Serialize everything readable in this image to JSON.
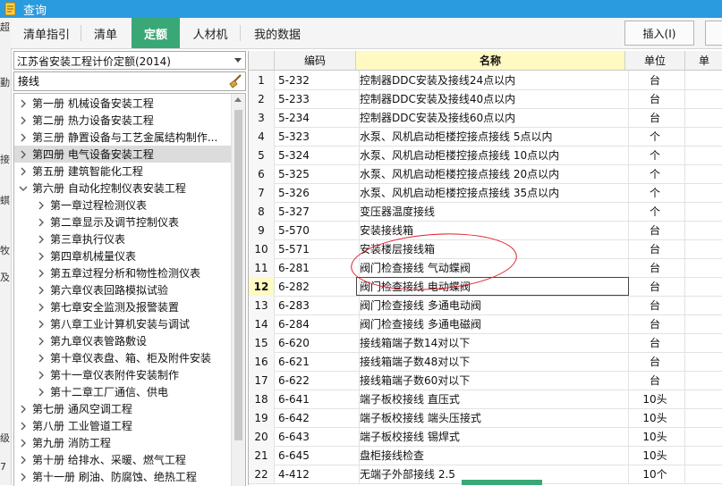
{
  "window": {
    "title": "查询"
  },
  "left_strip": [
    "超",
    "勤",
    "接",
    "蜞",
    "牧",
    "及",
    "级",
    "7"
  ],
  "tabs": [
    {
      "label": "清单指引",
      "active": false
    },
    {
      "label": "清单",
      "active": false
    },
    {
      "label": "定额",
      "active": true
    },
    {
      "label": "人材机",
      "active": false
    },
    {
      "label": "我的数据",
      "active": false
    }
  ],
  "toolbar": {
    "insert_label": "插入(I)"
  },
  "left_panel": {
    "quota_library": "江苏省安装工程计价定额(2014)",
    "search_value": "接线",
    "tree": [
      {
        "label": "第一册 机械设备安装工程",
        "level": 0,
        "expanded": false,
        "selected": false
      },
      {
        "label": "第二册 热力设备安装工程",
        "level": 0,
        "expanded": false,
        "selected": false
      },
      {
        "label": "第三册 静置设备与工艺金属结构制作...",
        "level": 0,
        "expanded": false,
        "selected": false
      },
      {
        "label": "第四册 电气设备安装工程",
        "level": 0,
        "expanded": false,
        "selected": true
      },
      {
        "label": "第五册 建筑智能化工程",
        "level": 0,
        "expanded": false,
        "selected": false
      },
      {
        "label": "第六册 自动化控制仪表安装工程",
        "level": 0,
        "expanded": true,
        "selected": false
      },
      {
        "label": "第一章过程检测仪表",
        "level": 1,
        "expanded": false,
        "selected": false
      },
      {
        "label": "第二章显示及调节控制仪表",
        "level": 1,
        "expanded": false,
        "selected": false
      },
      {
        "label": "第三章执行仪表",
        "level": 1,
        "expanded": false,
        "selected": false
      },
      {
        "label": "第四章机械量仪表",
        "level": 1,
        "expanded": false,
        "selected": false
      },
      {
        "label": "第五章过程分析和物性检测仪表",
        "level": 1,
        "expanded": false,
        "selected": false
      },
      {
        "label": "第六章仪表回路模拟试验",
        "level": 1,
        "expanded": false,
        "selected": false
      },
      {
        "label": "第七章安全监测及报警装置",
        "level": 1,
        "expanded": false,
        "selected": false
      },
      {
        "label": "第八章工业计算机安装与调试",
        "level": 1,
        "expanded": false,
        "selected": false
      },
      {
        "label": "第九章仪表管路敷设",
        "level": 1,
        "expanded": false,
        "selected": false
      },
      {
        "label": "第十章仪表盘、箱、柜及附件安装",
        "level": 1,
        "expanded": false,
        "selected": false
      },
      {
        "label": "第十一章仪表附件安装制作",
        "level": 1,
        "expanded": false,
        "selected": false
      },
      {
        "label": "第十二章工厂通信、供电",
        "level": 1,
        "expanded": false,
        "selected": false
      },
      {
        "label": "第七册 通风空调工程",
        "level": 0,
        "expanded": false,
        "selected": false
      },
      {
        "label": "第八册 工业管道工程",
        "level": 0,
        "expanded": false,
        "selected": false
      },
      {
        "label": "第九册 消防工程",
        "level": 0,
        "expanded": false,
        "selected": false
      },
      {
        "label": "第十册 给排水、采暖、燃气工程",
        "level": 0,
        "expanded": false,
        "selected": false
      },
      {
        "label": "第十一册 刷油、防腐蚀、绝热工程",
        "level": 0,
        "expanded": false,
        "selected": false
      }
    ]
  },
  "table": {
    "columns": {
      "code": "编码",
      "name": "名称",
      "unit": "单位",
      "extra": "单"
    },
    "current_row": "12",
    "rows": [
      {
        "idx": "1",
        "code": "5-232",
        "name": "控制器DDC安装及接线24点以内",
        "unit": "台"
      },
      {
        "idx": "2",
        "code": "5-233",
        "name": "控制器DDC安装及接线40点以内",
        "unit": "台"
      },
      {
        "idx": "3",
        "code": "5-234",
        "name": "控制器DDC安装及接线60点以内",
        "unit": "台"
      },
      {
        "idx": "4",
        "code": "5-323",
        "name": "水泵、风机启动柜楼控接点接线 5点以内",
        "unit": "个"
      },
      {
        "idx": "5",
        "code": "5-324",
        "name": "水泵、风机启动柜楼控接点接线 10点以内",
        "unit": "个"
      },
      {
        "idx": "6",
        "code": "5-325",
        "name": "水泵、风机启动柜楼控接点接线 20点以内",
        "unit": "个"
      },
      {
        "idx": "7",
        "code": "5-326",
        "name": "水泵、风机启动柜楼控接点接线 35点以内",
        "unit": "个"
      },
      {
        "idx": "8",
        "code": "5-327",
        "name": "变压器温度接线",
        "unit": "个"
      },
      {
        "idx": "9",
        "code": "5-570",
        "name": "安装接线箱",
        "unit": "台"
      },
      {
        "idx": "10",
        "code": "5-571",
        "name": "安装楼层接线箱",
        "unit": "台"
      },
      {
        "idx": "11",
        "code": "6-281",
        "name": "阀门检查接线 气动蝶阀",
        "unit": "台"
      },
      {
        "idx": "12",
        "code": "6-282",
        "name": "阀门检查接线 电动蝶阀",
        "unit": "台"
      },
      {
        "idx": "13",
        "code": "6-283",
        "name": "阀门检查接线 多通电动阀",
        "unit": "台"
      },
      {
        "idx": "14",
        "code": "6-284",
        "name": "阀门检查接线 多通电磁阀",
        "unit": "台"
      },
      {
        "idx": "15",
        "code": "6-620",
        "name": "接线箱端子数14对以下",
        "unit": "台"
      },
      {
        "idx": "16",
        "code": "6-621",
        "name": "接线箱端子数48对以下",
        "unit": "台"
      },
      {
        "idx": "17",
        "code": "6-622",
        "name": "接线箱端子数60对以下",
        "unit": "台"
      },
      {
        "idx": "18",
        "code": "6-641",
        "name": "端子板校接线 直压式",
        "unit": "10头"
      },
      {
        "idx": "19",
        "code": "6-642",
        "name": "端子板校接线 端头压接式",
        "unit": "10头"
      },
      {
        "idx": "20",
        "code": "6-643",
        "name": "端子板校接线 锡焊式",
        "unit": "10头"
      },
      {
        "idx": "21",
        "code": "6-645",
        "name": "盘柜接线检查",
        "unit": "10头"
      },
      {
        "idx": "22",
        "code": "4-412",
        "name": "无端子外部接线 2.5",
        "unit": "10个"
      }
    ]
  },
  "colors": {
    "titlebar": "#2b9be0",
    "active_tab": "#3aa876",
    "header_highlight": "#fff9c2",
    "annotation": "#e0202b"
  }
}
